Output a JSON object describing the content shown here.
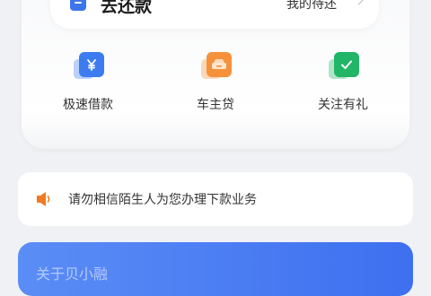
{
  "repay": {
    "title": "去还款",
    "pending_label": "我的待还",
    "icon": "repay-doc-icon"
  },
  "actions": [
    {
      "label": "极速借款",
      "icon": "yuan-card-icon",
      "color": "#3d7cf0"
    },
    {
      "label": "车主贷",
      "icon": "car-icon",
      "color": "#f5913b"
    },
    {
      "label": "关注有礼",
      "icon": "check-card-icon",
      "color": "#21b568"
    }
  ],
  "notice": {
    "text": "请勿相信陌生人为您办理下款业务",
    "icon": "speaker-icon",
    "icon_color": "#f07a22"
  },
  "banner": {
    "text": "关于贝小融",
    "color": "#4a7ef2"
  }
}
